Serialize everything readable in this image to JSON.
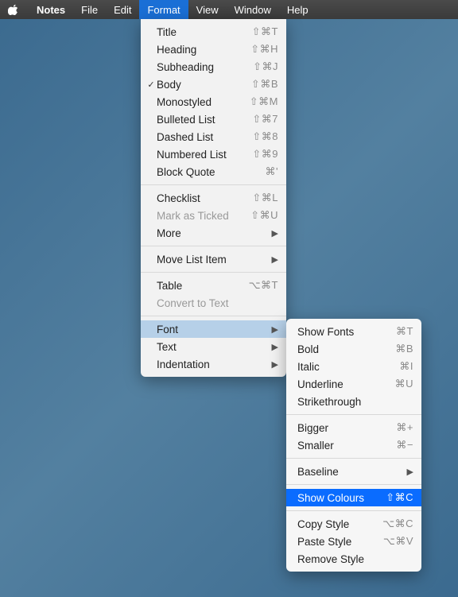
{
  "menubar": {
    "app": "Notes",
    "items": [
      "File",
      "Edit",
      "Format",
      "View",
      "Window",
      "Help"
    ],
    "active": "Format"
  },
  "format_menu": {
    "group1": [
      {
        "label": "Title",
        "shortcut": "⇧⌘T",
        "checked": false
      },
      {
        "label": "Heading",
        "shortcut": "⇧⌘H",
        "checked": false
      },
      {
        "label": "Subheading",
        "shortcut": "⇧⌘J",
        "checked": false
      },
      {
        "label": "Body",
        "shortcut": "⇧⌘B",
        "checked": true
      },
      {
        "label": "Monostyled",
        "shortcut": "⇧⌘M",
        "checked": false
      },
      {
        "label": "Bulleted List",
        "shortcut": "⇧⌘7",
        "checked": false
      },
      {
        "label": "Dashed List",
        "shortcut": "⇧⌘8",
        "checked": false
      },
      {
        "label": "Numbered List",
        "shortcut": "⇧⌘9",
        "checked": false
      },
      {
        "label": "Block Quote",
        "shortcut": "⌘'",
        "checked": false
      }
    ],
    "group2": [
      {
        "label": "Checklist",
        "shortcut": "⇧⌘L",
        "disabled": false
      },
      {
        "label": "Mark as Ticked",
        "shortcut": "⇧⌘U",
        "disabled": true
      },
      {
        "label": "More",
        "submenu": true
      }
    ],
    "group3": [
      {
        "label": "Move List Item",
        "submenu": true
      }
    ],
    "group4": [
      {
        "label": "Table",
        "shortcut": "⌥⌘T"
      },
      {
        "label": "Convert to Text",
        "disabled": true
      }
    ],
    "group5": [
      {
        "label": "Font",
        "submenu": true,
        "highlight": true
      },
      {
        "label": "Text",
        "submenu": true
      },
      {
        "label": "Indentation",
        "submenu": true
      }
    ]
  },
  "font_submenu": {
    "group1": [
      {
        "label": "Show Fonts",
        "shortcut": "⌘T"
      },
      {
        "label": "Bold",
        "shortcut": "⌘B"
      },
      {
        "label": "Italic",
        "shortcut": "⌘I"
      },
      {
        "label": "Underline",
        "shortcut": "⌘U"
      },
      {
        "label": "Strikethrough"
      }
    ],
    "group2": [
      {
        "label": "Bigger",
        "shortcut": "⌘+"
      },
      {
        "label": "Smaller",
        "shortcut": "⌘−"
      }
    ],
    "group3": [
      {
        "label": "Baseline",
        "submenu": true
      }
    ],
    "group4": [
      {
        "label": "Show Colours",
        "shortcut": "⇧⌘C",
        "highlight": true
      }
    ],
    "group5": [
      {
        "label": "Copy Style",
        "shortcut": "⌥⌘C"
      },
      {
        "label": "Paste Style",
        "shortcut": "⌥⌘V"
      },
      {
        "label": "Remove Style"
      }
    ]
  }
}
